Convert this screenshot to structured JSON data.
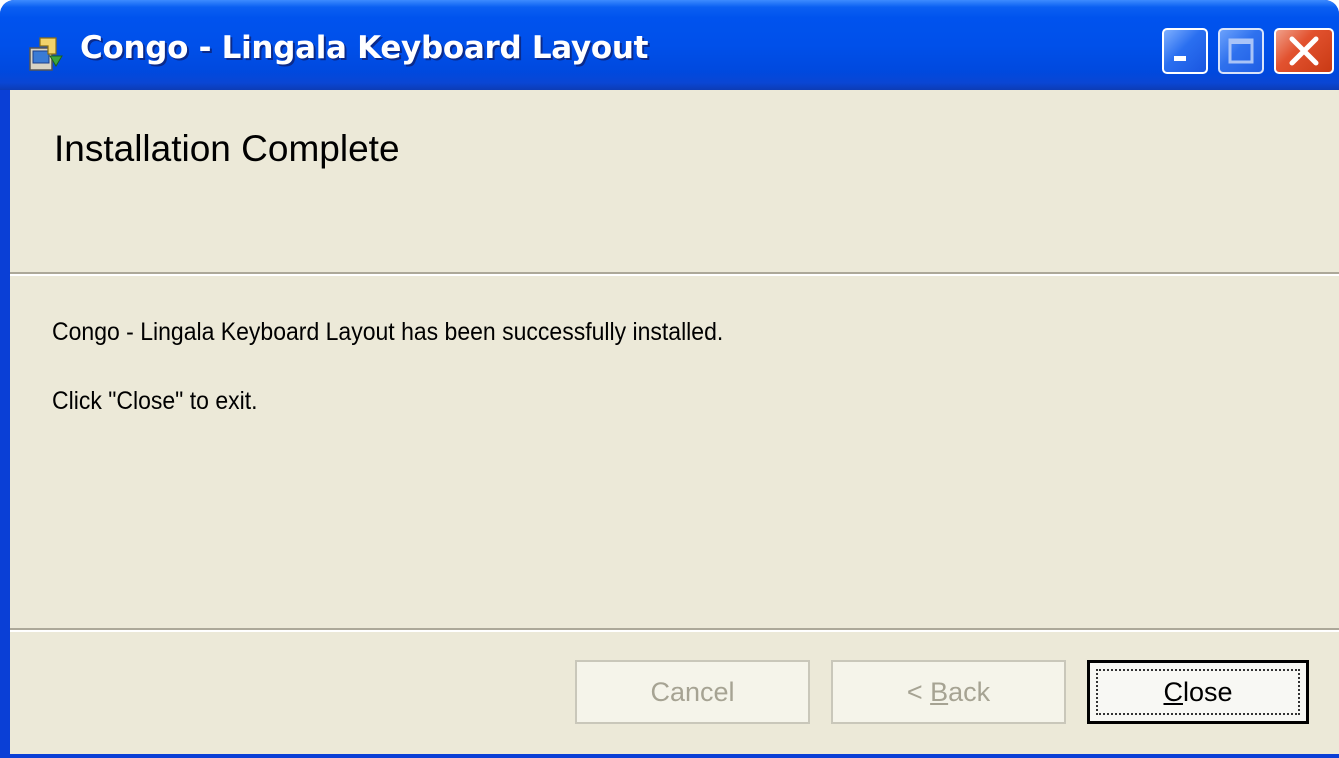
{
  "window": {
    "title": "Congo - Lingala Keyboard Layout",
    "icon": "installer-icon",
    "controls": {
      "minimize": "minimize-icon",
      "maximize": "maximize-icon",
      "close": "close-icon"
    }
  },
  "page": {
    "heading": "Installation Complete",
    "message": "Congo - Lingala Keyboard Layout has been successfully installed.",
    "instruction": "Click \"Close\" to exit."
  },
  "buttons": {
    "cancel": {
      "label": "Cancel",
      "enabled": false
    },
    "back": {
      "prefix": "< ",
      "accel": "B",
      "rest": "ack",
      "enabled": false
    },
    "close": {
      "accel": "C",
      "rest": "lose",
      "enabled": true,
      "default": true
    }
  },
  "colors": {
    "titlebar": "#0053ee",
    "dialog_bg": "#ece9d8",
    "close_button": "#e2522f"
  }
}
